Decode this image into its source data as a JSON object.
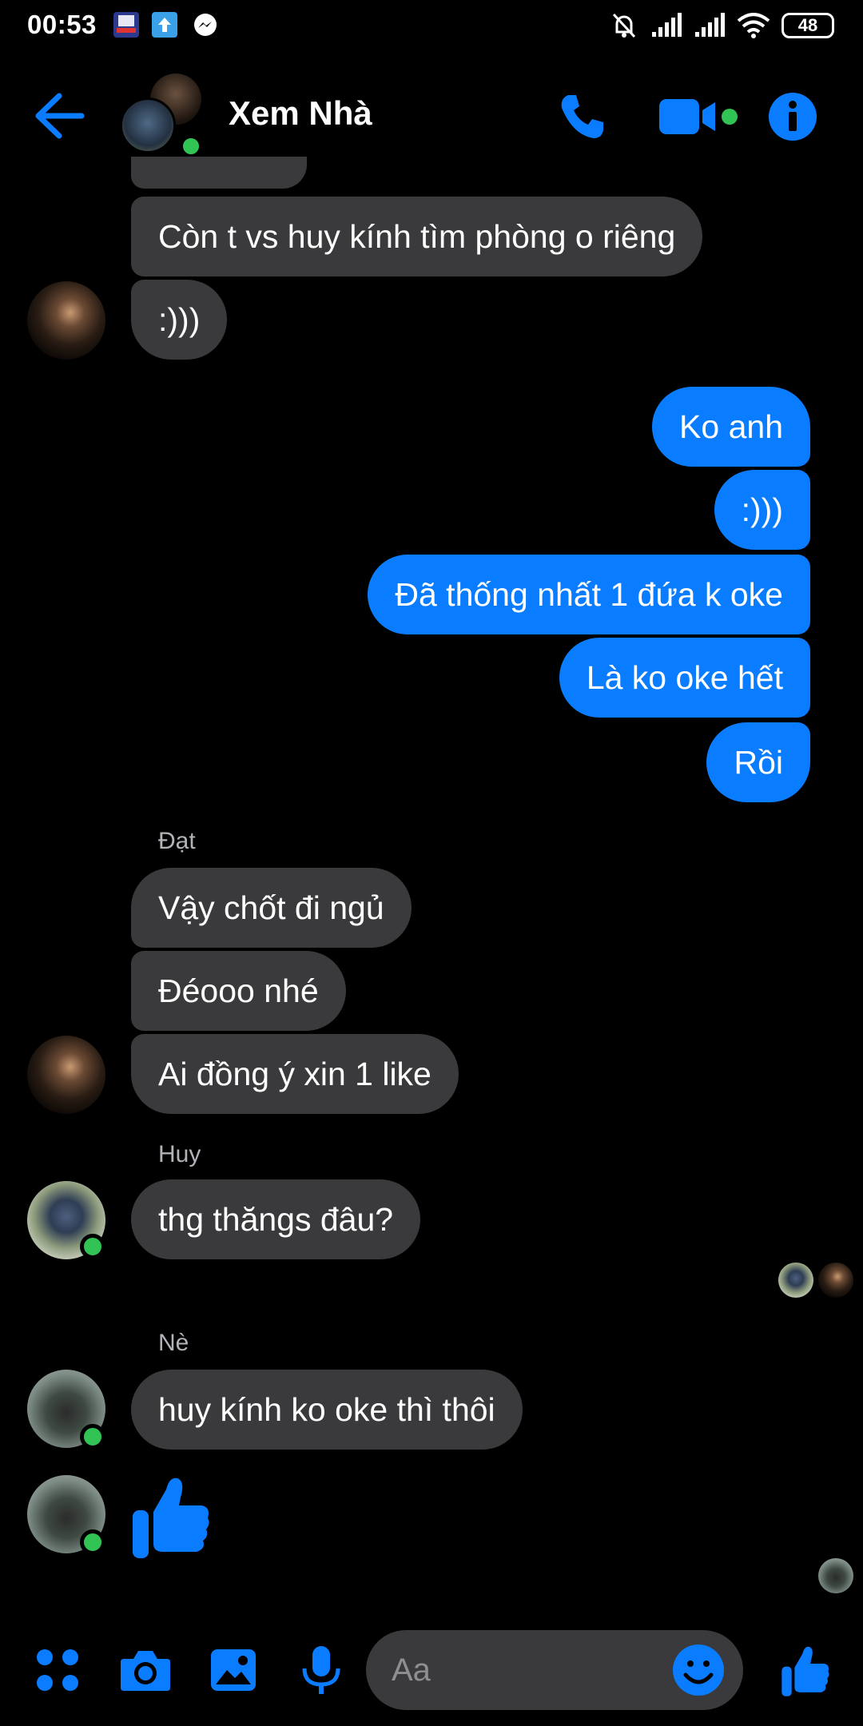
{
  "status_bar": {
    "time": "00:53",
    "battery": "48",
    "icons": [
      "bidv-app-icon",
      "upload-icon",
      "messenger-icon",
      "silent-icon",
      "signal-icon",
      "signal-icon",
      "wifi-icon",
      "battery-icon"
    ]
  },
  "header": {
    "title": "Xem Nhà",
    "icons": [
      "back-arrow-icon",
      "phone-icon",
      "video-camera-icon",
      "info-icon"
    ],
    "accent_color": "#0a7cff",
    "online_color": "#31c454"
  },
  "messages": [
    {
      "text": "Còn t vs huy kính tìm phòng o riêng",
      "from": "in"
    },
    {
      "text": ":)))",
      "from": "in"
    },
    {
      "text": "Ko anh",
      "from": "out"
    },
    {
      "text": ":)))",
      "from": "out"
    },
    {
      "text": "Đã thống nhất 1 đứa k oke",
      "from": "out"
    },
    {
      "text": "Là ko oke hết",
      "from": "out"
    },
    {
      "text": "Rồi",
      "from": "out"
    },
    {
      "text": "Vậy chốt đi ngủ",
      "from": "in"
    },
    {
      "text": "Đéooo nhé",
      "from": "in"
    },
    {
      "text": "Ai đồng ý xin 1 like",
      "from": "in"
    },
    {
      "text": "thg thăngs đâu?",
      "from": "in"
    },
    {
      "text": "huy kính ko oke thì thôi",
      "from": "in"
    }
  ],
  "senders": {
    "dat": "Đạt",
    "huy": "Huy",
    "ne": "Nè"
  },
  "composer": {
    "placeholder": "Aa",
    "icons": [
      "menu-grid-icon",
      "camera-icon",
      "image-icon",
      "microphone-icon",
      "emoji-icon",
      "thumbs-up-icon"
    ]
  },
  "colors": {
    "background": "#000000",
    "incoming_bubble": "#3a3a3c",
    "outgoing_bubble": "#0a7cff"
  }
}
